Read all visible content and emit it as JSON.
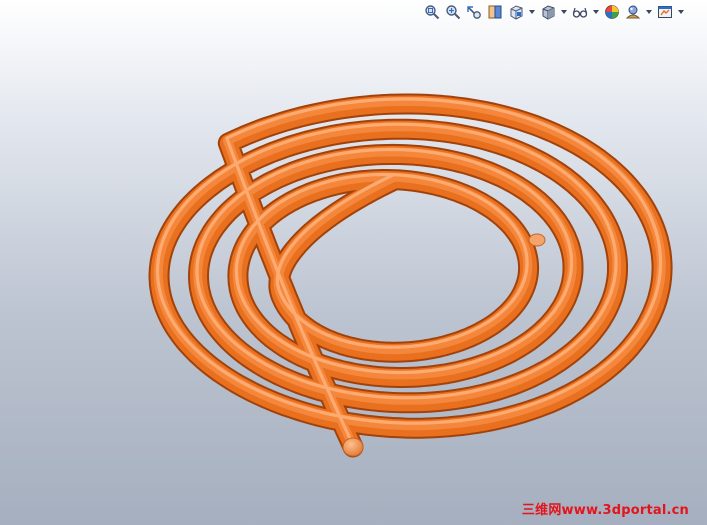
{
  "watermark": {
    "text": "三维网www.3dportal.cn",
    "color": "#e3141c"
  },
  "model": {
    "color": "#e8701e",
    "highlight": "#ffb27a",
    "shadow": "#a2420b",
    "end_cap_color": "#f09a55"
  },
  "heads_up_toolbar": {
    "buttons": [
      {
        "icon": "zoom-to-fit-icon"
      },
      {
        "icon": "zoom-to-area-icon"
      },
      {
        "icon": "previous-view-icon"
      },
      {
        "icon": "section-view-icon"
      },
      {
        "icon": "view-orientation-icon",
        "dropdown": true
      },
      {
        "icon": "display-style-icon",
        "dropdown": true
      },
      {
        "icon": "hide-show-items-icon",
        "dropdown": true
      },
      {
        "icon": "edit-appearance-icon"
      },
      {
        "icon": "apply-scene-icon",
        "dropdown": true
      },
      {
        "icon": "view-settings-icon",
        "dropdown": true
      }
    ]
  }
}
